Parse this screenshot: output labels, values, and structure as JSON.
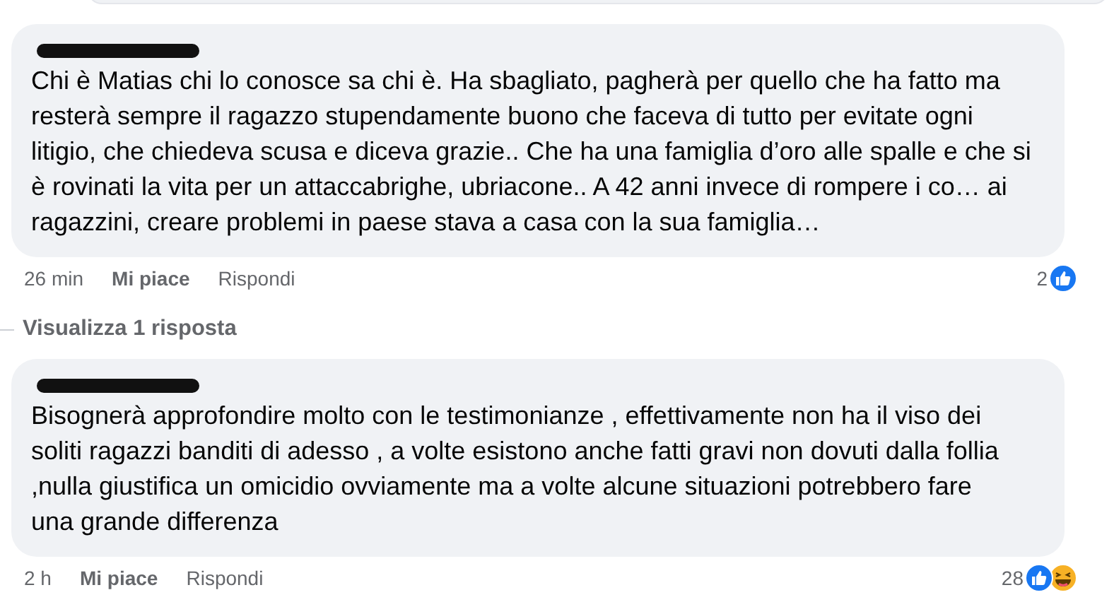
{
  "comments": [
    {
      "lines": [
        "Chi è Matias chi lo conosce sa chi è. Ha sbagliato, pagherà per quello che ha fatto ma",
        "resterà sempre il ragazzo stupendamente buono che faceva di tutto per evitate ogni",
        "litigio, che chiedeva scusa e diceva grazie.. Che ha una famiglia d’oro alle spalle e che si",
        "è rovinati la vita per un attaccabrighe, ubriacone.. A 42 anni invece di rompere i co… ai",
        "ragazzini, creare problemi in paese stava a casa con la sua famiglia…"
      ],
      "time": "26 min",
      "like": "Mi piace",
      "reply": "Rispondi",
      "reaction_count": "2",
      "reactions": [
        {
          "kind": "like"
        }
      ],
      "replies_link": "Visualizza 1 risposta"
    },
    {
      "lines": [
        "Bisognerà approfondire molto con le testimonianze , effettivamente non ha il viso dei",
        "soliti ragazzi banditi di adesso , a volte esistono anche fatti gravi non dovuti dalla follia",
        ",nulla giustifica un omicidio ovviamente ma a volte alcune situazioni potrebbero fare",
        "una grande differenza"
      ],
      "time": "2 h",
      "like": "Mi piace",
      "reply": "Rispondi",
      "reaction_count": "28",
      "reactions": [
        {
          "kind": "like"
        },
        {
          "kind": "haha"
        }
      ]
    }
  ]
}
